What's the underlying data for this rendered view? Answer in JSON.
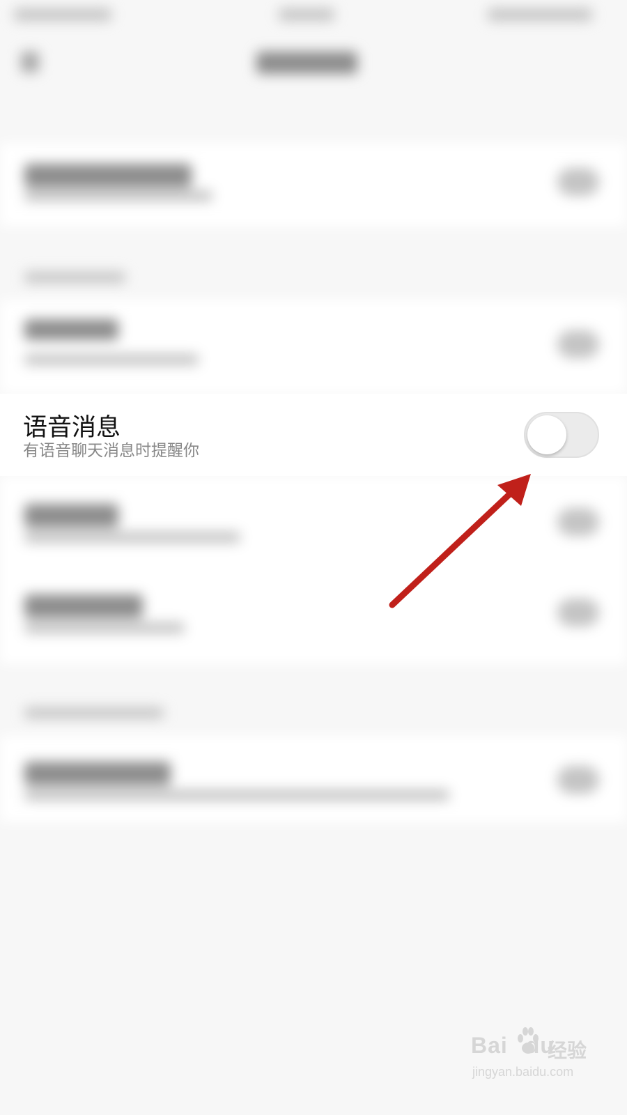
{
  "setting": {
    "title": "语音消息",
    "description": "有语音聊天消息时提醒你",
    "toggle_on": false
  },
  "watermark": {
    "logo_text": "Bai",
    "logo_text_2": "du",
    "cn_text": "经验",
    "url": "jingyan.baidu.com"
  },
  "colors": {
    "arrow": "#c0201a",
    "toggle_track": "#ebebeb",
    "background": "#f7f7f7"
  }
}
